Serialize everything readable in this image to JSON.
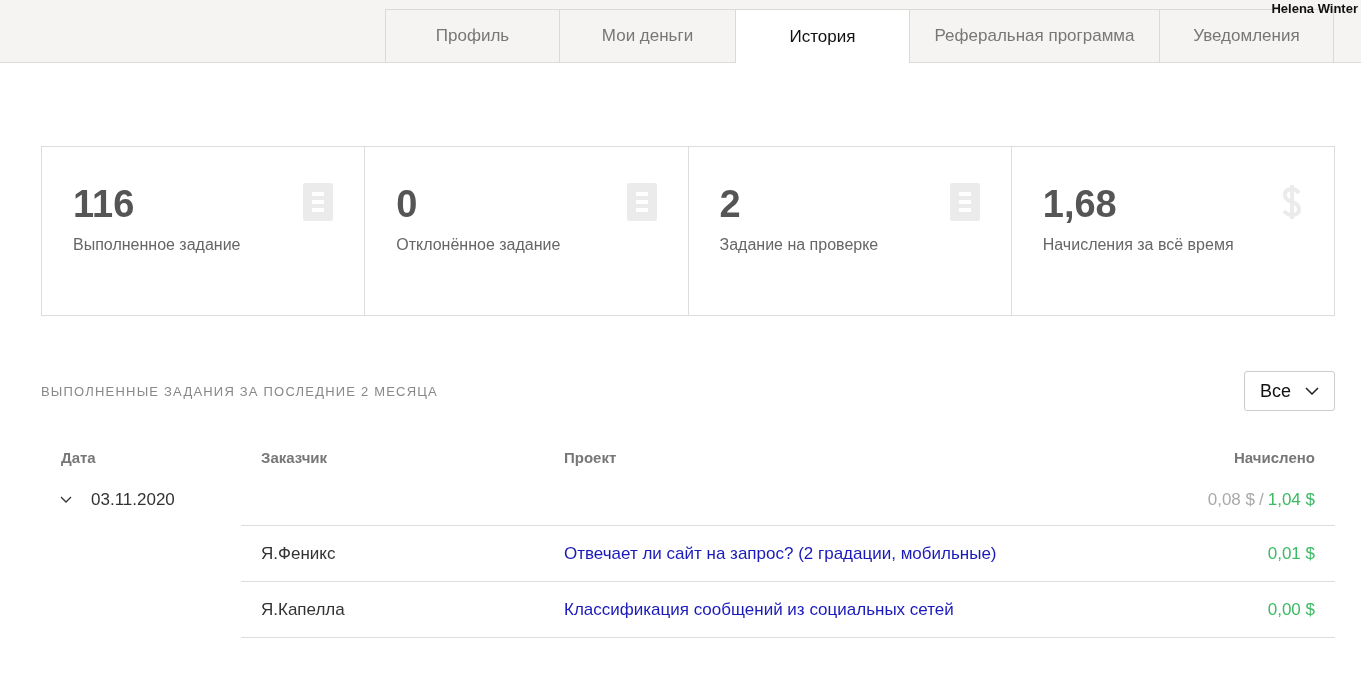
{
  "user": {
    "name": "Helena Winter"
  },
  "tabs": [
    {
      "label": "Профиль",
      "selected": false
    },
    {
      "label": "Мои деньги",
      "selected": false
    },
    {
      "label": "История",
      "selected": true
    },
    {
      "label": "Реферальная программа",
      "selected": false
    },
    {
      "label": "Уведомления",
      "selected": false
    }
  ],
  "stats": [
    {
      "value": "116",
      "label": "Выполненное задание",
      "kind": "list"
    },
    {
      "value": "0",
      "label": "Отклонённое задание",
      "kind": "list"
    },
    {
      "value": "2",
      "label": "Задание на проверке",
      "kind": "list"
    },
    {
      "value": "1,68",
      "label": "Начисления за всё время",
      "kind": "dollar"
    }
  ],
  "section_title": "ВЫПОЛНЕННЫЕ ЗАДАНИЯ ЗА ПОСЛЕДНИЕ 2 МЕСЯЦА",
  "filter": {
    "value": "Все"
  },
  "table": {
    "columns": [
      "Дата",
      "Заказчик",
      "Проект",
      "Начислено"
    ],
    "groups": [
      {
        "date": "03.11.2020",
        "expanded": true,
        "pending": "0,08 $",
        "separator": "/",
        "total": "1,04 $",
        "rows": [
          {
            "customer": "Я.Феникс",
            "project": "Отвечает ли сайт на запрос? (2 градации, мобильные)",
            "amount": "0,01 $"
          },
          {
            "customer": "Я.Капелла",
            "project": "Классификация сообщений из социальных сетей",
            "amount": "0,00 $"
          }
        ]
      }
    ]
  }
}
